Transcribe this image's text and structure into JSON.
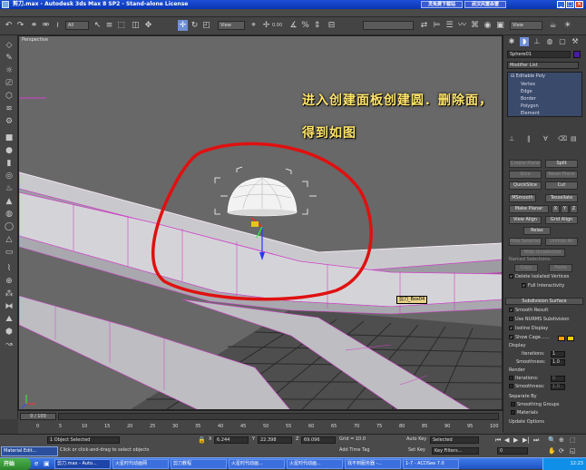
{
  "window": {
    "title": "剪刀.max - Autodesk 3ds Max 8 SP2  - Stand-alone License",
    "top_tab_1": "灵免费下载站",
    "top_tab_2": "武汉风雷杀雷",
    "min": "_",
    "max": "□",
    "close": "×"
  },
  "toolbar": {
    "selection_filter": "All",
    "ref_coord": "View",
    "named_sel": "View",
    "named_sets": "",
    "snap_value": "0.00"
  },
  "viewport": {
    "label": "Perspective",
    "annotation_line1": "进入创建面板创建圆．删除面，",
    "annotation_line2": "得到如图",
    "object_tag": "剪刀_Box04"
  },
  "command_panel": {
    "object_name": "Sphere01",
    "modifier_list": "Modifier List",
    "stack": {
      "root": "Editable Poly",
      "items": [
        "Vertex",
        "Edge",
        "Border",
        "Polygon",
        "Element"
      ]
    },
    "buttons": {
      "create": "Create Plane",
      "split": "Split",
      "slice": "Slice",
      "reset_plane": "Reset Plane",
      "quickslice": "QuickSlice",
      "cut": "Cut",
      "msmooth": "MSmooth",
      "tessellate": "Tessellate",
      "make_planar": "Make Planar",
      "x": "X",
      "y": "Y",
      "z": "Z",
      "view_align": "View Align",
      "grid_align": "Grid Align",
      "relax": "Relax",
      "hide_selected": "Hide Selected",
      "unhide_all": "Unhide All",
      "hide_unselected": "Hide Unselected",
      "named_selections": "Named Selections:",
      "copy": "Copy",
      "paste": "Paste",
      "delete_isolated": "Delete Isolated Vertices",
      "full_interactivity": "Full Interactivity"
    },
    "subdivision": {
      "title": "Subdivision Surface",
      "smooth_result": "Smooth Result",
      "use_nurms": "Use NURMS Subdivision",
      "isoline": "Isoline Display",
      "show_cage": "Show Cage......",
      "display": "Display",
      "iterations": "Iterations:",
      "iterations_val": "1",
      "smoothness": "Smoothness:",
      "smoothness_val": "1.0",
      "render": "Render",
      "r_iterations": "Iterations:",
      "r_iterations_val": "0",
      "r_smoothness": "Smoothness:",
      "r_smoothness_val": "1.0",
      "separate_by": "Separate By",
      "smoothing_groups": "Smoothing Groups",
      "materials": "Materials",
      "update_options": "Update Options"
    },
    "colors": {
      "object": "#4a1aa8",
      "cage1": "#f0a000",
      "cage2": "#f0d000"
    }
  },
  "timeline": {
    "slider": "0 / 100",
    "ticks": [
      "0",
      "5",
      "10",
      "15",
      "20",
      "25",
      "30",
      "35",
      "40",
      "45",
      "50",
      "55",
      "60",
      "65",
      "70",
      "75",
      "80",
      "85",
      "90",
      "95",
      "100"
    ]
  },
  "status": {
    "selected": "1 Object Selected",
    "prompt": "Click or click-and-drag to select objects",
    "x_label": "X",
    "x_val": "6.244",
    "y_label": "Y",
    "y_val": "22.398",
    "z_label": "Z",
    "z_val": "69.096",
    "grid": "Grid = 10.0",
    "auto_key": "Auto Key",
    "set_key": "Set Key",
    "selected_dd": "Selected",
    "key_filters": "Key Filters...",
    "add_time_tag": "Add Time Tag",
    "frame": "0"
  },
  "mat_editor": "Material Edit...",
  "taskbar": {
    "start": "开始",
    "items": [
      "剪刀.max - Auto...",
      "火星时代动画网",
      "剪刀教程",
      "火星时代动画...",
      "火星时代动画...",
      "找不到服务器 -...",
      "1-7 - ACDSee 7.0"
    ],
    "clock": "12:23"
  }
}
